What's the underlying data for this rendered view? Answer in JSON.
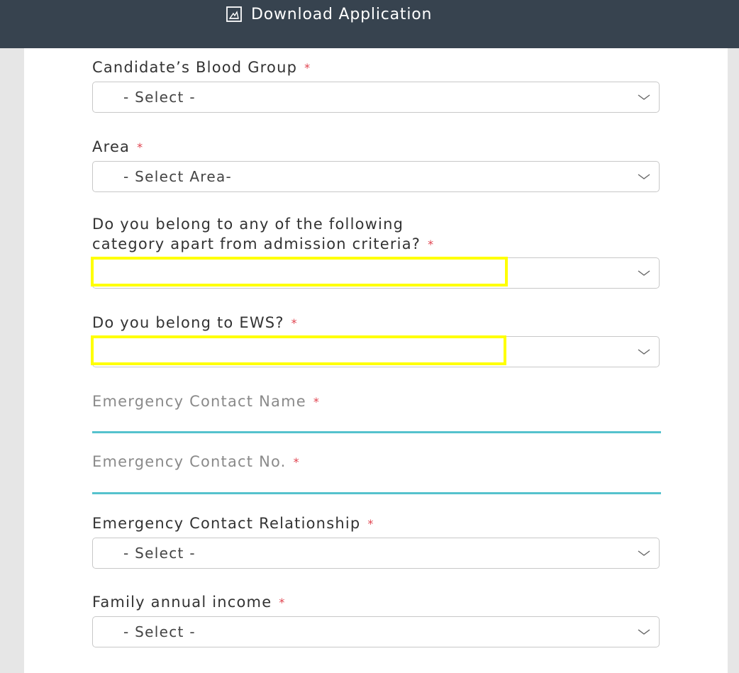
{
  "header": {
    "download_label": "Download Application"
  },
  "form": {
    "blood_group": {
      "label": "Candidate’s Blood Group",
      "required": "*",
      "value": "- Select -"
    },
    "area": {
      "label": "Area",
      "required": "*",
      "value": "- Select Area-"
    },
    "category": {
      "label_line1": "Do you belong to any of the following",
      "label_line2": "category apart from admission criteria?",
      "required": "*",
      "value": ""
    },
    "ews": {
      "label": "Do you belong to EWS?",
      "required": "*",
      "value": ""
    },
    "emergency_name": {
      "placeholder": "Emergency Contact Name",
      "required": "*"
    },
    "emergency_no": {
      "placeholder": "Emergency Contact No.",
      "required": "*"
    },
    "emergency_relationship": {
      "label": "Emergency Contact Relationship",
      "required": "*",
      "value": "- Select -"
    },
    "family_income": {
      "label": "Family annual income",
      "required": "*",
      "value": "- Select -"
    }
  },
  "colors": {
    "header_bg": "#37434f",
    "required_mark": "#e0434f",
    "input_underline": "#55c2cd",
    "highlight": "#ffff00"
  },
  "icons": {
    "download": "pdf-document-icon",
    "dropdown": "chevron-down-icon",
    "required": "asterisk-icon"
  }
}
